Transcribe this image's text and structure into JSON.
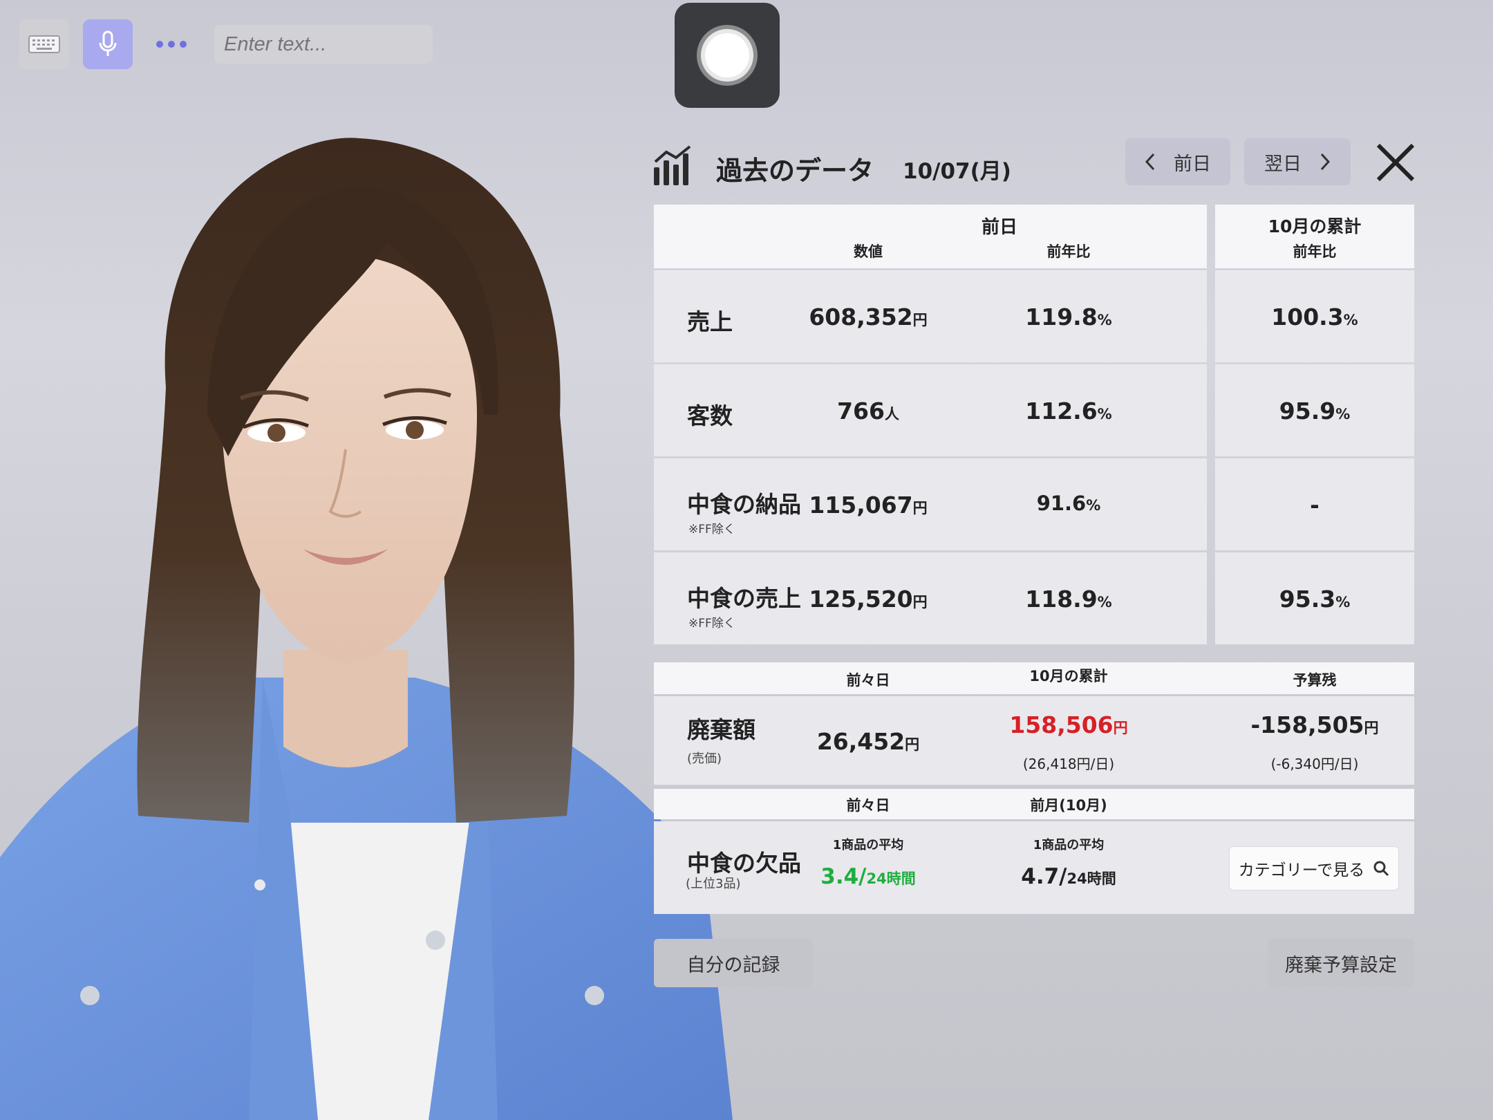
{
  "toolbar": {
    "input_placeholder": "Enter text...",
    "icons": [
      "keyboard-icon",
      "microphone-icon",
      "more-icon"
    ]
  },
  "record_button": {
    "icon": "record-icon"
  },
  "panel": {
    "title": "過去のデータ",
    "date": "10/07(月)",
    "prev_label": "前日",
    "next_label": "翌日"
  },
  "table1": {
    "group_prev": "前日",
    "group_month": "10月の累計",
    "col_value": "数値",
    "col_yoy": "前年比",
    "col_month_yoy": "前年比",
    "rows": [
      {
        "label": "売上",
        "note": "",
        "value": "608,352",
        "value_unit": "円",
        "yoy": "119.8",
        "yoy_unit": "%",
        "month_yoy": "100.3",
        "month_unit": "%"
      },
      {
        "label": "客数",
        "note": "",
        "value": "766",
        "value_unit": "人",
        "yoy": "112.6",
        "yoy_unit": "%",
        "month_yoy": "95.9",
        "month_unit": "%"
      },
      {
        "label": "中食の納品",
        "note": "※FF除く",
        "value": "115,067",
        "value_unit": "円",
        "yoy": "91.6",
        "yoy_unit": "%",
        "month_yoy": "-",
        "month_unit": ""
      },
      {
        "label": "中食の売上",
        "note": "※FF除く",
        "value": "125,520",
        "value_unit": "円",
        "yoy": "118.9",
        "yoy_unit": "%",
        "month_yoy": "95.3",
        "month_unit": "%"
      }
    ]
  },
  "table2": {
    "col_day": "前々日",
    "col_month": "10月の累計",
    "col_budget": "予算残",
    "label": "廃棄額",
    "note": "(売価)",
    "day_value": "26,452",
    "day_unit": "円",
    "month_value": "158,506",
    "month_unit": "円",
    "month_sub": "(26,418円/日)",
    "budget_value": "-158,505",
    "budget_unit": "円",
    "budget_sub": "(-6,340円/日)",
    "month_color": "#d81f26"
  },
  "table3": {
    "col_day": "前々日",
    "col_month": "前月(10月)",
    "label": "中食の欠品",
    "note": "(上位3品)",
    "day_caption": "1商品の平均",
    "day_value": "3.4/",
    "day_unit": "24時間",
    "month_caption": "1商品の平均",
    "month_value": "4.7/",
    "month_unit": "24時間",
    "day_color": "#1fae3e",
    "category_button": "カテゴリーで見る"
  },
  "buttons": {
    "record": "自分の記録",
    "budget": "廃棄予算設定"
  }
}
